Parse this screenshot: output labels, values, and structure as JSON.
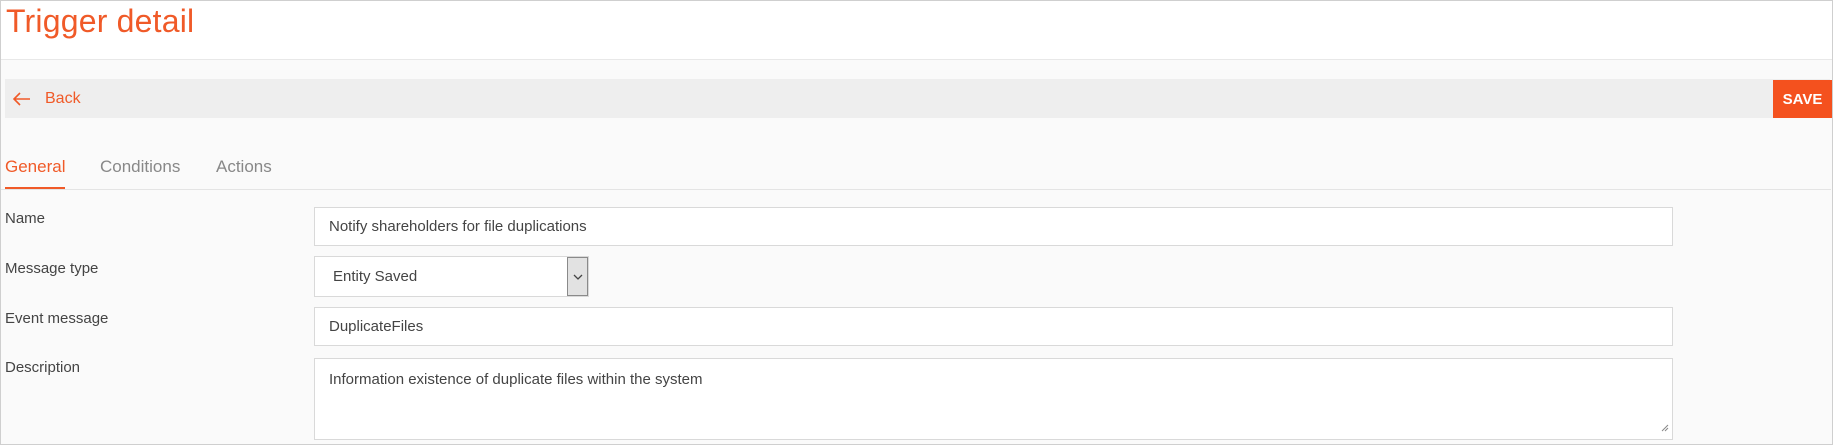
{
  "header": {
    "title": "Trigger detail"
  },
  "toolbar": {
    "back_label": "Back",
    "save_label": "SAVE",
    "back_icon": "arrow-left-icon"
  },
  "tabs": [
    {
      "label": "General",
      "active": true
    },
    {
      "label": "Conditions",
      "active": false
    },
    {
      "label": "Actions",
      "active": false
    }
  ],
  "form": {
    "name": {
      "label": "Name",
      "value": "Notify shareholders for file duplications"
    },
    "message_type": {
      "label": "Message type",
      "value": "Entity Saved"
    },
    "event_message": {
      "label": "Event message",
      "value": "DuplicateFiles"
    },
    "description": {
      "label": "Description",
      "value": "Information existence of duplicate files within the system"
    }
  },
  "colors": {
    "accent": "#f05a28",
    "save_button": "#f4511e"
  }
}
